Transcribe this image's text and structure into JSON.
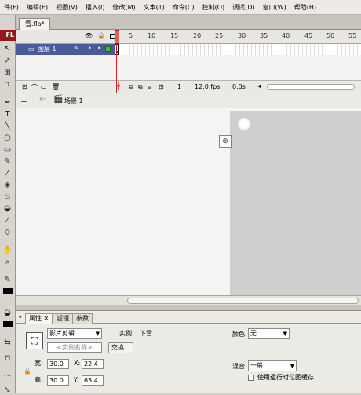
{
  "menubar": {
    "items": [
      "件(F)",
      "编辑(E)",
      "视图(V)",
      "插入(I)",
      "修改(M)",
      "文本(T)",
      "命令(C)",
      "控制(O)",
      "调试(D)",
      "窗口(W)",
      "帮助(H)"
    ]
  },
  "toolbox": {
    "brand": "FL"
  },
  "document": {
    "tab_label": "雪.fla*"
  },
  "timeline": {
    "ruler": [
      "5",
      "10",
      "15",
      "20",
      "25",
      "30",
      "35",
      "40",
      "45",
      "50",
      "55"
    ],
    "layer_name": "图层 1",
    "frame": "1",
    "fps": "12.0 fps",
    "time": "0.0s"
  },
  "scene": {
    "label": "场景 1"
  },
  "properties": {
    "tabs": [
      "属性",
      "滤镜",
      "参数"
    ],
    "symbol_type": "影片剪辑",
    "instance_label": "实例:",
    "instance_value": "下雪",
    "instance_name_placeholder": "<实例名称>",
    "swap_button": "交换...",
    "width_label": "宽:",
    "width_value": "30.0",
    "height_label": "高:",
    "height_value": "30.0",
    "x_label": "X:",
    "x_value": "22.4",
    "y_label": "Y:",
    "y_value": "63.4",
    "color_label": "颜色:",
    "color_value": "无",
    "blend_label": "混合:",
    "blend_value": "一般",
    "runtime_bitmap_label": "使用运行时位图缓存"
  },
  "colors": {
    "brand": "#8f1818",
    "layer_selected": "#4a5b9a",
    "playhead": "#d02020",
    "stage": "#cfcfcf"
  }
}
